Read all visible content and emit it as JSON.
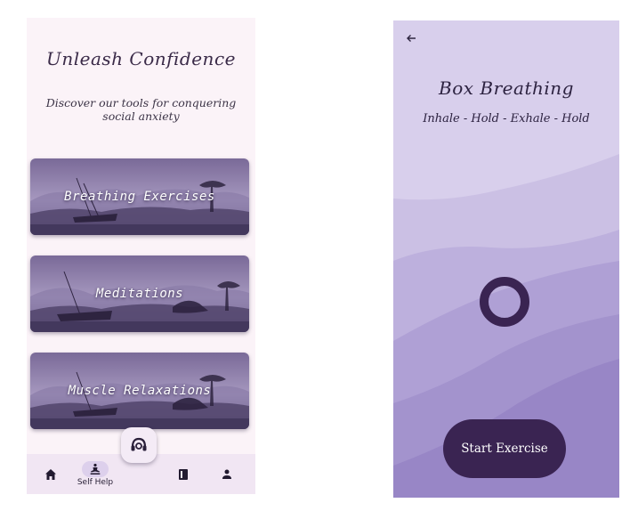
{
  "self_help": {
    "title": "Unleash Confidence",
    "subtitle": "Discover our tools for conquering social anxiety",
    "cards": [
      {
        "label": "Breathing Exercises"
      },
      {
        "label": "Meditations"
      },
      {
        "label": "Muscle Relaxations"
      }
    ],
    "nav": {
      "items": [
        {
          "icon": "home-icon",
          "label": ""
        },
        {
          "icon": "meditation-icon",
          "label": "Self Help",
          "active": true
        },
        {
          "icon": "book-icon",
          "label": ""
        },
        {
          "icon": "person-icon",
          "label": ""
        }
      ],
      "fab_icon": "headset-support-icon"
    }
  },
  "box_breathing": {
    "back_icon": "arrow-left-icon",
    "title": "Box Breathing",
    "subtitle": "Inhale - Hold - Exhale - Hold",
    "start_button": "Start Exercise"
  },
  "colors": {
    "accent_dark": "#3a2452",
    "lavender_bg": "#d8cfec",
    "page_bg": "#fbf3f8"
  }
}
